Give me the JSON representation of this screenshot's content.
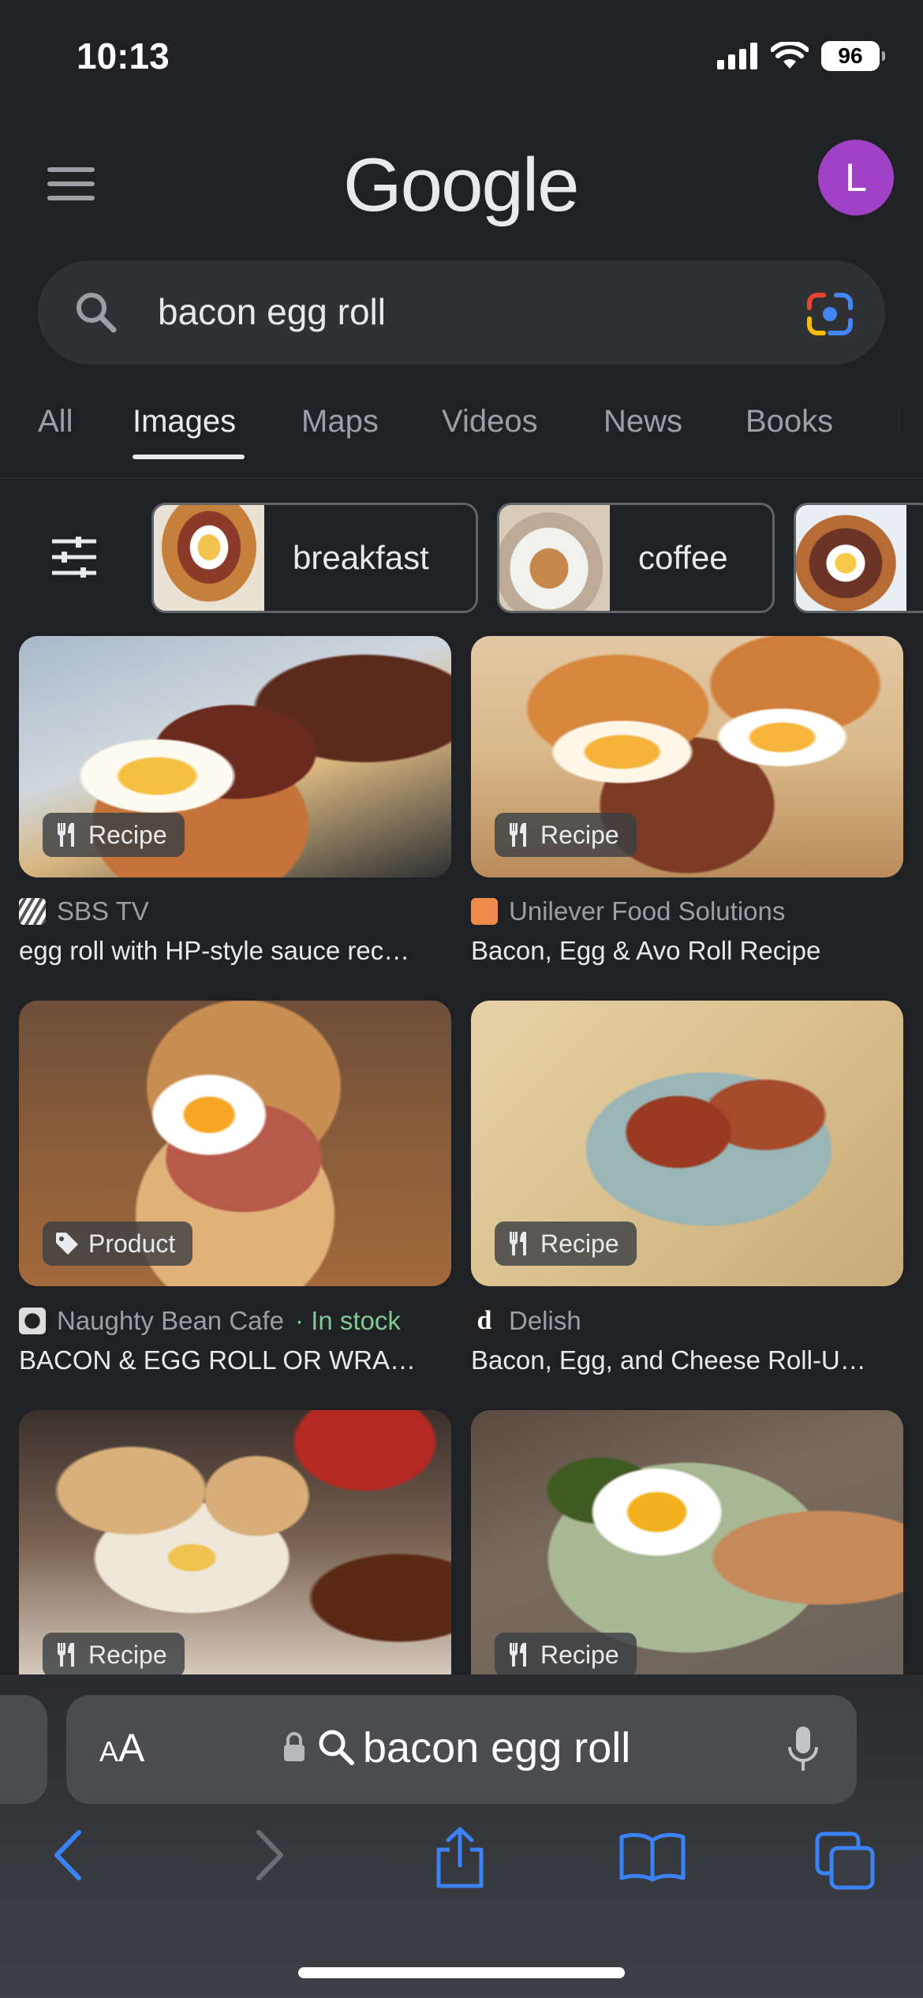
{
  "status": {
    "time": "10:13",
    "battery": "96"
  },
  "header": {
    "logo": "Google",
    "avatar_letter": "L"
  },
  "search": {
    "query": "bacon egg roll"
  },
  "tabs": [
    {
      "label": "All"
    },
    {
      "label": "Images",
      "active": true
    },
    {
      "label": "Maps"
    },
    {
      "label": "Videos"
    },
    {
      "label": "News"
    },
    {
      "label": "Books"
    },
    {
      "label": "Fl"
    }
  ],
  "chips": [
    {
      "label": "breakfast"
    },
    {
      "label": "coffee"
    },
    {
      "label": ""
    }
  ],
  "results": [
    {
      "badge": "Recipe",
      "badge_icon": "fork-knife-icon",
      "source": "SBS TV",
      "title": "egg roll with HP-style sauce rec…"
    },
    {
      "badge": "Recipe",
      "badge_icon": "fork-knife-icon",
      "source": "Unilever Food Solutions",
      "title": "Bacon, Egg & Avo Roll Recipe"
    },
    {
      "badge": "Product",
      "badge_icon": "tag-icon",
      "source": "Naughty Bean Cafe",
      "stock": "· In stock",
      "title": "BACON & EGG ROLL OR WRA…"
    },
    {
      "badge": "Recipe",
      "badge_icon": "fork-knife-icon",
      "source": "Delish",
      "title": "Bacon, Egg, and Cheese Roll-U…"
    },
    {
      "badge": "Recipe",
      "badge_icon": "fork-knife-icon"
    },
    {
      "badge": "Recipe",
      "badge_icon": "fork-knife-icon"
    }
  ],
  "browser": {
    "text_size": "AA",
    "url": "bacon egg roll"
  },
  "colors": {
    "background": "#202124",
    "avatar": "#a142c6",
    "in_stock": "#81c995",
    "safari_blue": "#3b82f6"
  }
}
